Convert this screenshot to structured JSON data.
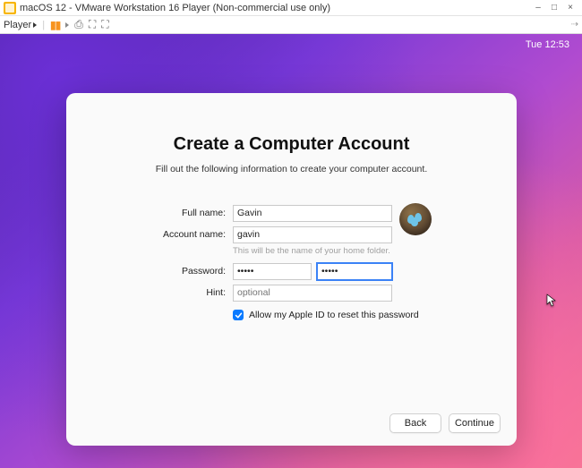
{
  "vmware": {
    "titlebar": "macOS 12 - VMware Workstation 16 Player (Non-commercial use only)",
    "player_menu": "Player",
    "min_label": "–",
    "max_label": "□",
    "close_label": "×",
    "extra_icon": "⇢"
  },
  "macos": {
    "clock": "Tue 12:53"
  },
  "setup": {
    "heading": "Create a Computer Account",
    "subhead": "Fill out the following information to create your computer account.",
    "labels": {
      "full_name": "Full name:",
      "account_name": "Account name:",
      "account_helper": "This will be the name of your home folder.",
      "password": "Password:",
      "hint": "Hint:"
    },
    "values": {
      "full_name": "Gavin",
      "account_name": "gavin",
      "password_main": "•••••",
      "password_verify": "•••••",
      "hint_placeholder": "optional"
    },
    "checkbox": {
      "checked": true,
      "label": "Allow my Apple ID to reset this password"
    },
    "avatar_name": "bird-nest-avatar",
    "buttons": {
      "back": "Back",
      "continue": "Continue"
    }
  }
}
